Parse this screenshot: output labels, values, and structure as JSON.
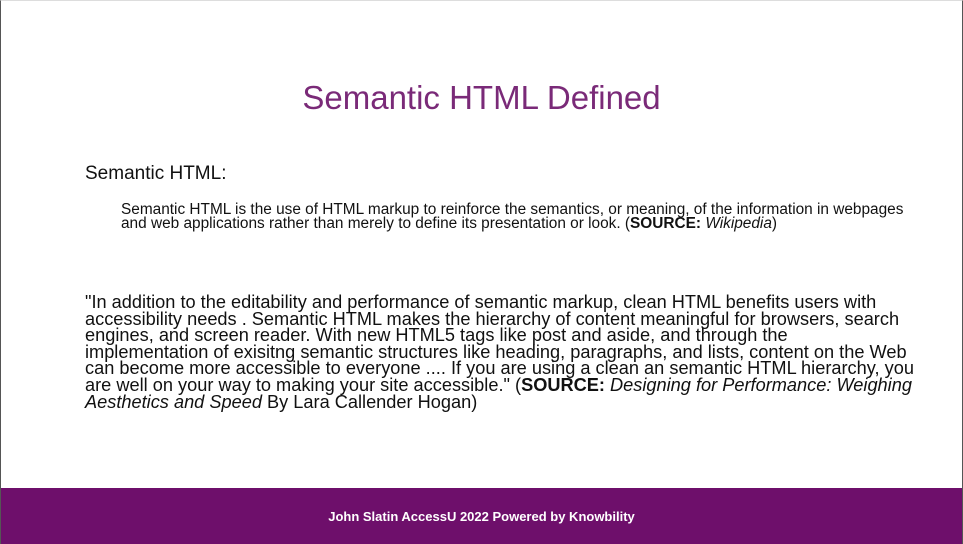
{
  "slide": {
    "title": "Semantic HTML Defined",
    "heading": "Semantic HTML:",
    "definition": {
      "text": "Semantic HTML is the use of HTML markup to reinforce the semantics, or meaning, of the information in webpages and web applications rather than merely to define its presentation or look. (",
      "source_label": "SOURCE:",
      "source_space": " ",
      "source_name": "Wikipedia",
      "close": ")"
    },
    "quote": {
      "text": "\"In addition to the editability and performance of semantic markup, clean HTML benefits users with accessibility needs . Semantic HTML makes the hierarchy of content meaningful for browsers, search engines, and screen reader.  With new HTML5 tags like post and aside, and through the implementation of exisitng semantic structures like heading, paragraphs, and lists, content on the Web can become more accessible to everyone .... If you are using a clean an semantic HTML hierarchy, you are well on your way to making your site accessible.\" (",
      "source_label": "SOURCE:",
      "source_space": " ",
      "source_title": "Designing for Performance: Weighing Aesthetics and Speed",
      "source_author": " By Lara Callender Hogan",
      "close": ")"
    },
    "footer": "John Slatin AccessU 2022 Powered by Knowbility"
  },
  "colors": {
    "title": "#7a2a78",
    "footer_bg": "#6e0f6b",
    "footer_text": "#ffffff",
    "body_text": "#111111"
  }
}
